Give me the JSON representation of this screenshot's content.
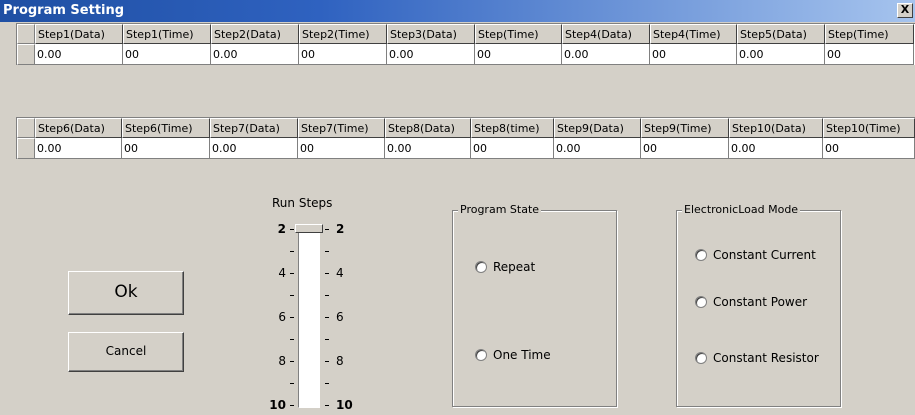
{
  "window": {
    "title": "Program Setting",
    "close_glyph": "X"
  },
  "table1": {
    "headers": [
      "Step1(Data)",
      "Step1(Time)",
      "Step2(Data)",
      "Step2(Time)",
      "Step3(Data)",
      "Step(Time)",
      "Step4(Data)",
      "Step4(Time)",
      "Step5(Data)",
      "Step(Time)"
    ],
    "values": [
      "0.00",
      "00",
      "0.00",
      "00",
      "0.00",
      "00",
      "0.00",
      "00",
      "0.00",
      "00"
    ]
  },
  "table2": {
    "headers": [
      "Step6(Data)",
      "Step6(Time)",
      "Step7(Data)",
      "Step7(Time)",
      "Step8(Data)",
      "Step8(time)",
      "Step9(Data)",
      "Step9(Time)",
      "Step10(Data)",
      "Step10(Time)"
    ],
    "values": [
      "0.00",
      "00",
      "0.00",
      "00",
      "0.00",
      "00",
      "0.00",
      "00",
      "0.00",
      "00"
    ]
  },
  "buttons": {
    "ok": "Ok",
    "cancel": "Cancel"
  },
  "run_steps": {
    "label": "Run Steps",
    "value": 2,
    "min": 2,
    "max": 10,
    "left_labels": [
      "2",
      "4",
      "6",
      "8",
      "10"
    ],
    "right_labels": [
      "2",
      "4",
      "6",
      "8",
      "10"
    ]
  },
  "program_state": {
    "title": "Program State",
    "options": [
      "Repeat",
      "One Time"
    ]
  },
  "load_mode": {
    "title": "ElectronicLoad Mode",
    "options": [
      "Constant Current",
      "Constant Power",
      "Constant Resistor"
    ]
  }
}
